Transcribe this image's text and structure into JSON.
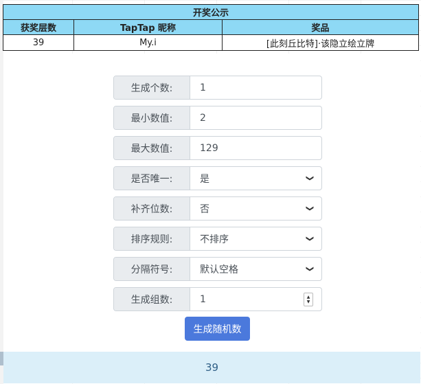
{
  "prize_table": {
    "title": "开奖公示",
    "headers": [
      "获奖层数",
      "TapTap 昵称",
      "奖品"
    ],
    "rows": [
      [
        "39",
        "My.i",
        "[此刻丘比特]·该隐立绘立牌"
      ]
    ]
  },
  "form": {
    "fields": [
      {
        "label": "生成个数:",
        "value": "1",
        "type": "text"
      },
      {
        "label": "最小数值:",
        "value": "2",
        "type": "text"
      },
      {
        "label": "最大数值:",
        "value": "129",
        "type": "text"
      },
      {
        "label": "是否唯一:",
        "value": "是",
        "type": "select"
      },
      {
        "label": "补齐位数:",
        "value": "否",
        "type": "select"
      },
      {
        "label": "排序规则:",
        "value": "不排序",
        "type": "select"
      },
      {
        "label": "分隔符号:",
        "value": "默认空格",
        "type": "select"
      },
      {
        "label": "生成组数:",
        "value": "1",
        "type": "number"
      }
    ],
    "generate_label": "生成随机数"
  },
  "result": {
    "value": "39"
  },
  "colors": {
    "table_header": "#8ed9f5",
    "button": "#4b79dc",
    "result_bg": "#dbeff9",
    "result_text": "#2f5f86"
  },
  "icons": {
    "select": "chevron-down-icon",
    "number": "spinner-icon"
  }
}
